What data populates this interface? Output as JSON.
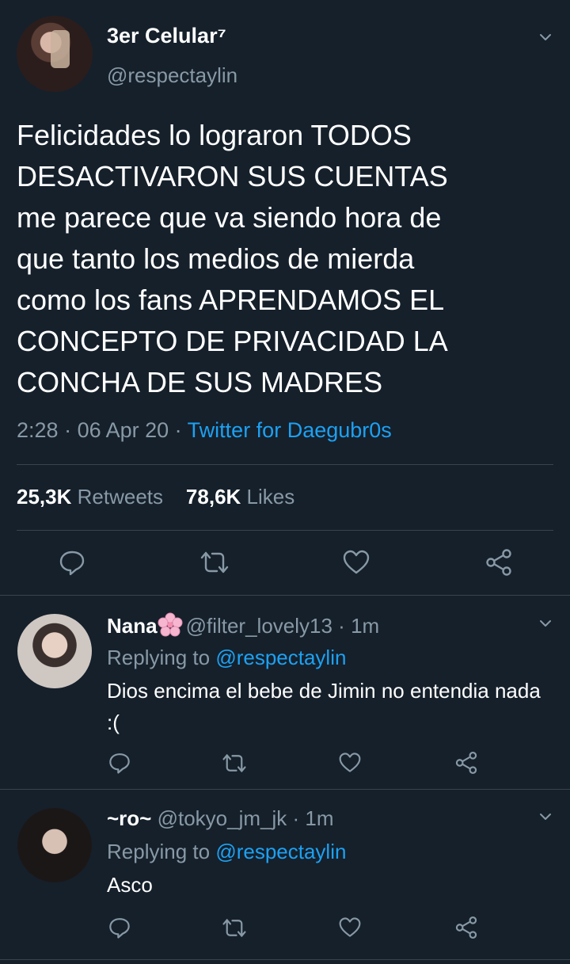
{
  "tweet": {
    "display_name": "3er Celular⁷",
    "handle": "@respectaylin",
    "text": "Felicidades lo lograron TODOS\nDESACTIVARON SUS CUENTAS\nme parece que va siendo hora de\nque tanto los medios de mierda\ncomo los fans APRENDAMOS EL\nCONCEPTO DE PRIVACIDAD LA\nCONCHA DE SUS MADRES",
    "time": "2:28",
    "date": "06 Apr 20",
    "separator": " · ",
    "source": "Twitter for Daegubr0s",
    "retweets_count": "25,3K",
    "retweets_label": "Retweets",
    "likes_count": "78,6K",
    "likes_label": "Likes"
  },
  "icons": {
    "reply": "reply-icon",
    "retweet": "retweet-icon",
    "like": "heart-icon",
    "share": "share-icon",
    "menu": "chevron-down-icon"
  },
  "colors": {
    "background": "#15202b",
    "secondary_text": "#8899a6",
    "link": "#1da1f2",
    "divider": "#38444d"
  },
  "replies": [
    {
      "name": "Nana",
      "handle": "@filter_lovely13",
      "time": "1m",
      "replying_prefix": "Replying to",
      "replying_to": "@respectaylin",
      "text": "Dios encima el bebe de Jimin no entendia nada :("
    },
    {
      "name": "~ro~",
      "handle": "@tokyo_jm_jk",
      "time": "1m",
      "replying_prefix": "Replying to",
      "replying_to": "@respectaylin",
      "text": "Asco"
    }
  ]
}
